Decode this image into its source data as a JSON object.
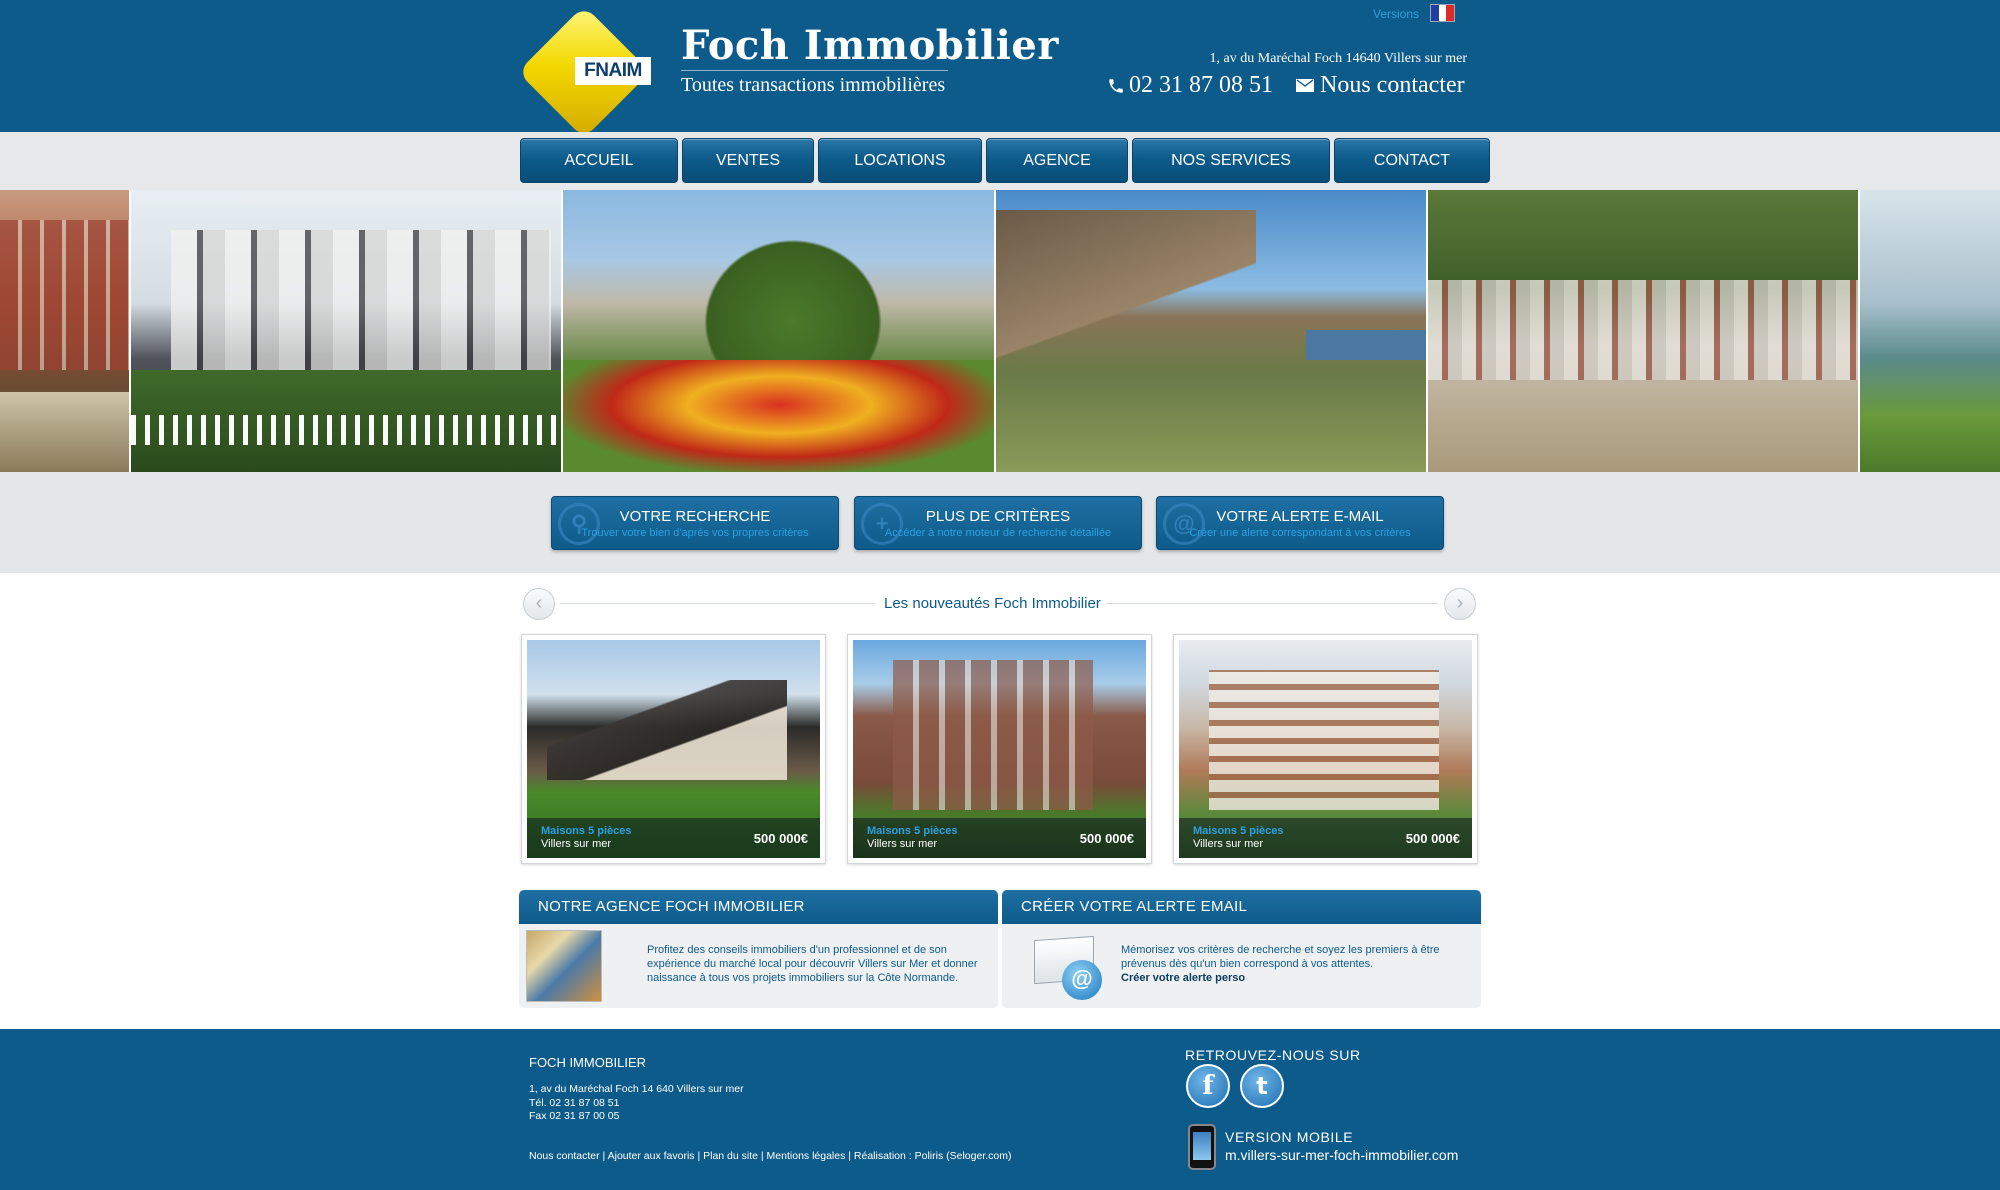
{
  "header": {
    "versions_label": "Versions",
    "logo_badge": "FNAIM",
    "brand": "Foch Immobilier",
    "tagline": "Toutes transactions immobilières",
    "address": "1, av du Maréchal Foch 14640 Villers sur mer",
    "phone": "02 31 87 08 51",
    "contact": "Nous contacter"
  },
  "nav": [
    {
      "label": "ACCUEIL"
    },
    {
      "label": "VENTES"
    },
    {
      "label": "LOCATIONS"
    },
    {
      "label": "AGENCE"
    },
    {
      "label": "NOS SERVICES"
    },
    {
      "label": "CONTACT"
    }
  ],
  "search_buttons": [
    {
      "title": "VOTRE RECHERCHE",
      "subtitle": "Trouver votre bien d'après vos propres critères",
      "icon": "magnifier-icon"
    },
    {
      "title": "PLUS DE CRITÈRES",
      "subtitle": "Accéder à notre moteur de recherche détaillée",
      "icon": "plus-icon"
    },
    {
      "title": "VOTRE ALERTE E-MAIL",
      "subtitle": "Créer une alerte correspondant à vos critères",
      "icon": "at-icon"
    }
  ],
  "news": {
    "title": "Les nouveautés Foch Immobilier",
    "cards": [
      {
        "type": "Maisons 5 pièces",
        "place": "Villers sur mer",
        "price": "500 000€"
      },
      {
        "type": "Maisons 5 pièces",
        "place": "Villers sur mer",
        "price": "500 000€"
      },
      {
        "type": "Maisons 5 pièces",
        "place": "Villers sur mer",
        "price": "500 000€"
      }
    ]
  },
  "agency_panel": {
    "title": "NOTRE AGENCE FOCH IMMOBILIER",
    "text": "Profitez des conseils immobiliers d'un professionnel et de son expérience du marché local pour découvrir Villers sur Mer et donner naissance à tous vos projets immobiliers sur la Côte Normande."
  },
  "alert_panel": {
    "title": "CRÉER VOTRE ALERTE EMAIL",
    "text": "Mémorisez vos critères de recherche et soyez les premiers à être prévenus dès qu'un bien correspond à vos attentes.",
    "link": "Créer votre alerte perso"
  },
  "footer": {
    "name": "FOCH IMMOBILIER",
    "address": "1, av du Maréchal Foch 14 640 Villers sur mer",
    "tel": "Tél. 02 31 87 08 51",
    "fax": "Fax 02 31 87 00 05",
    "links": "Nous contacter | Ajouter aux favoris | Plan du site | Mentions légales | Réalisation : Poliris (Seloger.com)",
    "find_us": "RETROUVEZ-NOUS SUR",
    "mobile_label": "VERSION MOBILE",
    "mobile_url": "m.villers-sur-mer-foch-immobilier.com"
  },
  "colors": {
    "primary": "#0d5b8a",
    "accent": "#2aa0e0",
    "logo_yellow": "#f3d800"
  }
}
